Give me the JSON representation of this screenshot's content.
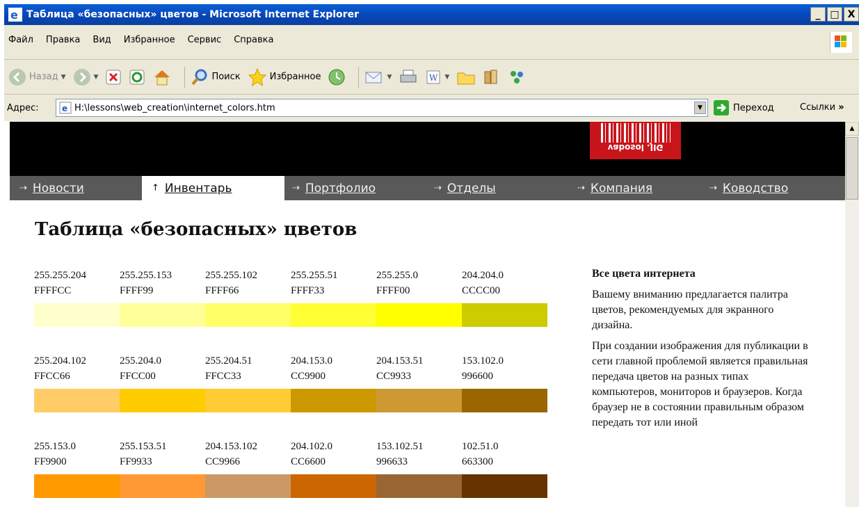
{
  "window": {
    "title": "Таблица «безопасных» цветов - Microsoft Internet Explorer",
    "buttons": [
      "_",
      "□",
      "X"
    ]
  },
  "menu": [
    "Файл",
    "Правка",
    "Вид",
    "Избранное",
    "Сервис",
    "Справка"
  ],
  "toolbar": {
    "back_label": "Назад",
    "search_label": "Поиск",
    "favorites_label": "Избранное"
  },
  "address": {
    "label": "Адрес:",
    "url": "H:\\lessons\\web_creation\\internet_colors.htm",
    "go_label": "Переход",
    "links_label": "Ссылки",
    "more": "»"
  },
  "site": {
    "logo_text": "vabosol .JIG",
    "nav": [
      {
        "label": "Новости",
        "arrow": "⇢",
        "active": false
      },
      {
        "label": "Инвентарь",
        "arrow": "↑",
        "active": true
      },
      {
        "label": "Портфолио",
        "arrow": "⇢",
        "active": false
      },
      {
        "label": "Отделы",
        "arrow": "⇢",
        "active": false
      },
      {
        "label": "Компания",
        "arrow": "⇢",
        "active": false
      },
      {
        "label": "Ководство",
        "arrow": "⇢",
        "active": false
      }
    ],
    "page_title": "Таблица «безопасных» цветов"
  },
  "swatches": [
    [
      {
        "rgb": "255.255.204",
        "hex": "FFFFCC",
        "color": "#FFFFCC"
      },
      {
        "rgb": "255.255.153",
        "hex": "FFFF99",
        "color": "#FFFF99"
      },
      {
        "rgb": "255.255.102",
        "hex": "FFFF66",
        "color": "#FFFF66"
      },
      {
        "rgb": "255.255.51",
        "hex": "FFFF33",
        "color": "#FFFF33"
      },
      {
        "rgb": "255.255.0",
        "hex": "FFFF00",
        "color": "#FFFF00"
      },
      {
        "rgb": "204.204.0",
        "hex": "CCCC00",
        "color": "#CCCC00"
      }
    ],
    [
      {
        "rgb": "255.204.102",
        "hex": "FFCC66",
        "color": "#FFCC66"
      },
      {
        "rgb": "255.204.0",
        "hex": "FFCC00",
        "color": "#FFCC00"
      },
      {
        "rgb": "255.204.51",
        "hex": "FFCC33",
        "color": "#FFCC33"
      },
      {
        "rgb": "204.153.0",
        "hex": "CC9900",
        "color": "#CC9900"
      },
      {
        "rgb": "204.153.51",
        "hex": "CC9933",
        "color": "#CC9933"
      },
      {
        "rgb": "153.102.0",
        "hex": "996600",
        "color": "#996600"
      }
    ],
    [
      {
        "rgb": "255.153.0",
        "hex": "FF9900",
        "color": "#FF9900"
      },
      {
        "rgb": "255.153.51",
        "hex": "FF9933",
        "color": "#FF9933"
      },
      {
        "rgb": "204.153.102",
        "hex": "CC9966",
        "color": "#CC9966"
      },
      {
        "rgb": "204.102.0",
        "hex": "CC6600",
        "color": "#CC6600"
      },
      {
        "rgb": "153.102.51",
        "hex": "996633",
        "color": "#996633"
      },
      {
        "rgb": "102.51.0",
        "hex": "663300",
        "color": "#663300"
      }
    ]
  ],
  "sidebar": {
    "heading": "Все цвета интернета",
    "p1": "Вашему вниманию предлагается палитра цветов, рекомендуемых для экранного дизайна.",
    "p2": "При создании изображения для публикации в сети главной проблемой является правильная передача цветов на разных типах компьютеров, мониторов и браузеров. Когда браузер не в состоянии правильным образом передать тот или иной"
  }
}
